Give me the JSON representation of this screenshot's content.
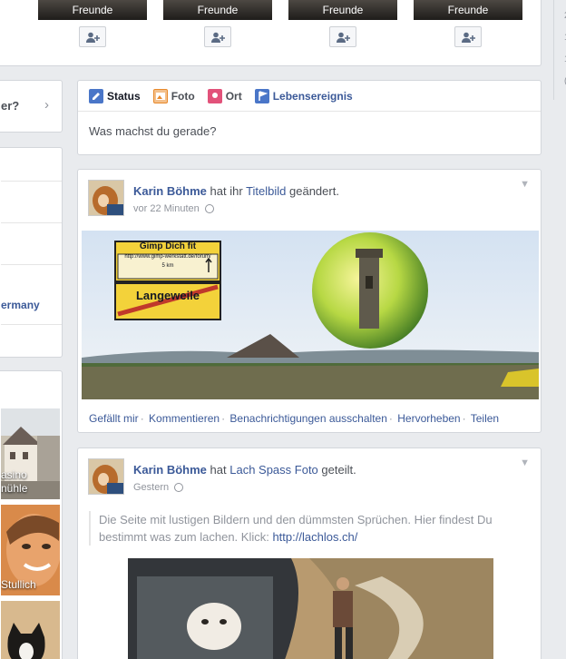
{
  "suggestions": {
    "items": [
      {
        "label": "Freunde"
      },
      {
        "label": "Freunde"
      },
      {
        "label": "Freunde"
      },
      {
        "label": "Freunde"
      }
    ]
  },
  "left": {
    "question_fragment": "er?",
    "country_fragment": "ermany",
    "photos": [
      {
        "caption": "asino\nnühle"
      },
      {
        "caption": "Stullich"
      },
      {
        "caption": ""
      }
    ]
  },
  "right": {
    "ticks": [
      "2",
      "1",
      "1",
      "("
    ]
  },
  "composer": {
    "tabs": [
      {
        "label": "Status",
        "color": "#4a76c8"
      },
      {
        "label": "Foto",
        "color": "#e8892b"
      },
      {
        "label": "Ort",
        "color": "#e2527a"
      },
      {
        "label": "Lebensereignis",
        "color": "#4a76c8"
      }
    ],
    "placeholder": "Was machst du gerade?"
  },
  "posts": [
    {
      "author": "Karin Böhme",
      "action_prefix": "hat ihr",
      "action_link": "Titelbild",
      "action_suffix": "geändert.",
      "time": "vor 22 Minuten",
      "cover_sign": {
        "title": "Gimp Dich fit",
        "url": "http://www.gimp-werkstatt.de/forum/",
        "distance": "5 km",
        "town": "Langeweile"
      },
      "actions": [
        "Gefällt mir",
        "Kommentieren",
        "Benachrichtigungen ausschalten",
        "Hervorheben",
        "Teilen"
      ]
    },
    {
      "author": "Karin Böhme",
      "action_prefix": "hat",
      "action_link": "Lach Spass Foto",
      "action_suffix": "geteilt.",
      "time": "Gestern",
      "shared_text": "Die Seite mit lustigen Bildern und den dümmsten Sprüchen. Hier findest Du bestimmt was zum lachen. Klick: ",
      "shared_link": "http://lachlos.ch/"
    }
  ],
  "colors": {
    "link": "#3b5998",
    "background": "#e9ebee"
  }
}
